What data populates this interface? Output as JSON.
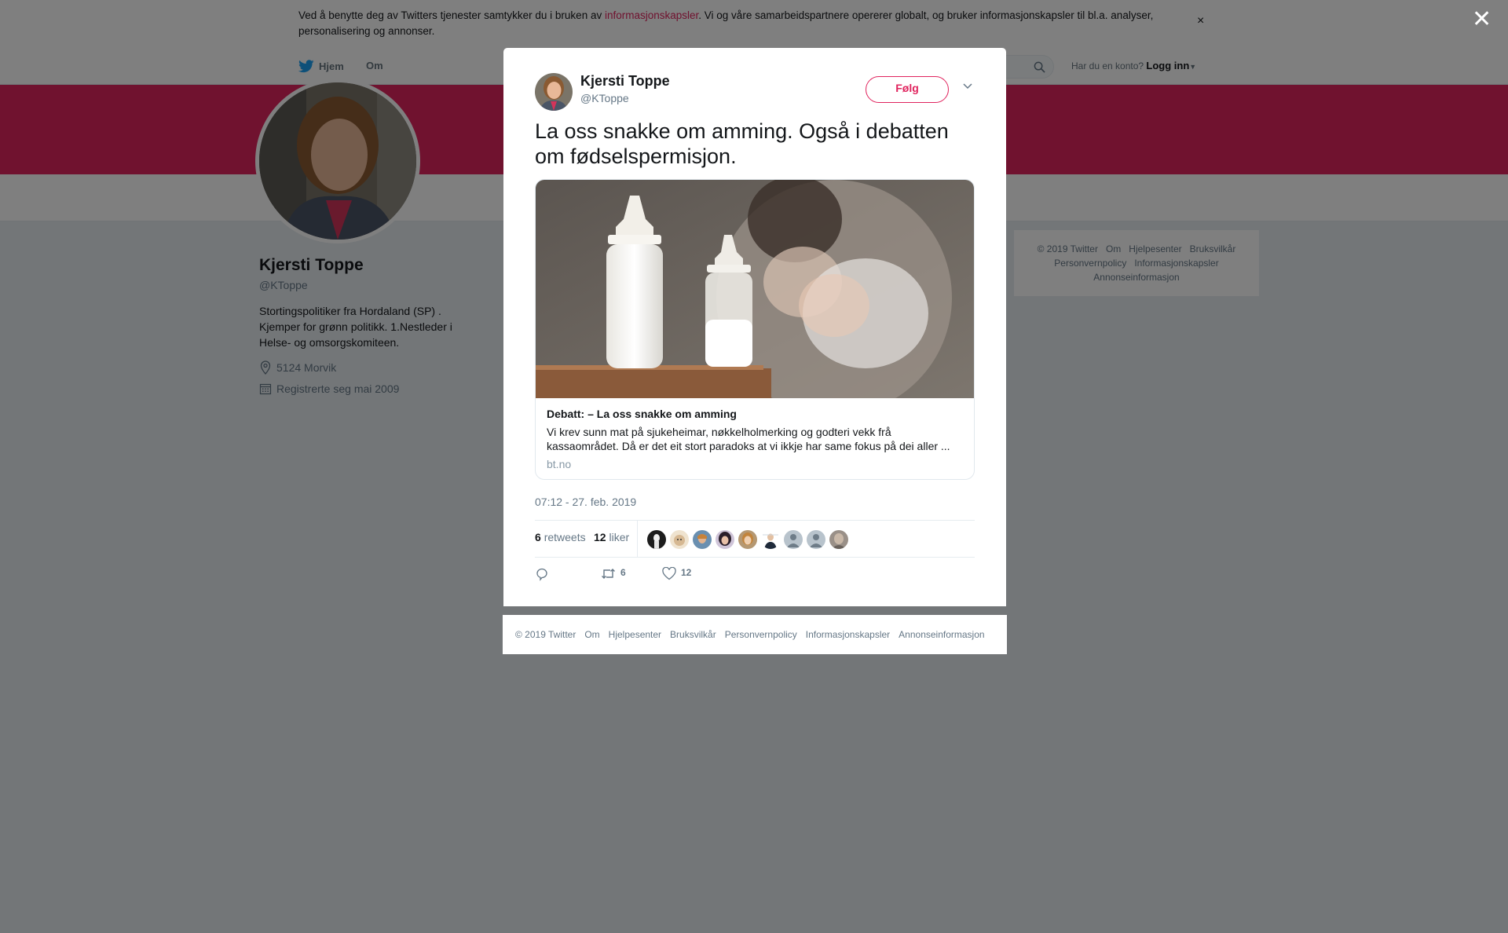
{
  "cookie_banner": {
    "text_before": "Ved å benytte deg av Twitters tjenester samtykker du i bruken av ",
    "link": "informasjonskapsler",
    "text_after": ". Vi og våre samarbeidspartnere opererer globalt, og bruker informasjonskapsler til bl.a. analyser, personalisering og annonser.",
    "close": "×"
  },
  "nav": {
    "home": "Hjem",
    "about": "Om",
    "account_prompt": "Har du en konto?",
    "login": "Logg inn"
  },
  "profile": {
    "name": "Kjersti Toppe",
    "handle": "@KToppe",
    "bio": "Stortingspolitiker fra Hordaland (SP) . Kjemper for grønn politikk. 1.Nestleder i Helse- og omsorgskomiteen.",
    "location": "5124 Morvik",
    "joined": "Registrerte seg mai 2009"
  },
  "side_footer": {
    "links": [
      "© 2019 Twitter",
      "Om",
      "Hjelpesenter",
      "Bruksvilkår",
      "Personvernpolicy",
      "Informasjonskapsler",
      "Annonseinformasjon"
    ]
  },
  "overlay": {
    "close": "✕"
  },
  "tweet": {
    "author_name": "Kjersti Toppe",
    "author_handle": "@KToppe",
    "follow_label": "Følg",
    "text": "La oss snakke om amming. Også i debatten om fødselspermisjon.",
    "card": {
      "title": "Debatt: – La oss snakke om amming",
      "description": "Vi krev sunn mat på sjukeheimar, nøkkelholmerking og godteri vekk frå kassaområdet. Då er det eit stort paradoks at vi ikkje har same fokus på dei aller ...",
      "domain": "bt.no"
    },
    "date": "07:12 - 27. feb. 2019",
    "retweets": "6",
    "retweets_label": "retweets",
    "likes": "12",
    "likes_label": "liker",
    "action_retweets": "6",
    "action_likes": "12"
  },
  "modal_footer": {
    "links": [
      "© 2019 Twitter",
      "Om",
      "Hjelpesenter",
      "Bruksvilkår",
      "Personvernpolicy",
      "Informasjonskapsler",
      "Annonseinformasjon"
    ]
  },
  "colors": {
    "accent": "#e0245e",
    "twitter_blue": "#1da1f2",
    "muted": "#657786"
  },
  "icons": [
    "twitter-bird-icon",
    "search-icon",
    "location-icon",
    "calendar-icon",
    "chevron-down-icon",
    "reply-icon",
    "retweet-icon",
    "heart-icon",
    "close-icon"
  ]
}
